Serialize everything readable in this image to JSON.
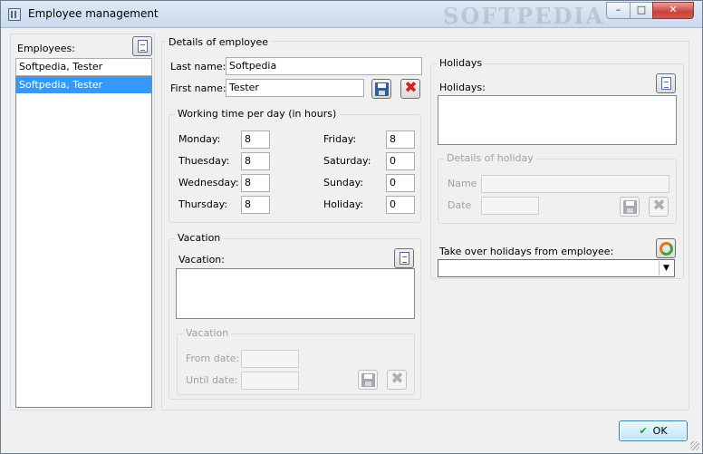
{
  "window": {
    "title": "Employee management",
    "watermark": "SOFTPEDIA",
    "min_glyph": "–",
    "max_glyph": "□",
    "close_glyph": "✕"
  },
  "employees": {
    "label": "Employees:",
    "search_value": "Softpedia, Tester",
    "items": [
      "Softpedia, Tester"
    ]
  },
  "details": {
    "group_title": "Details of employee",
    "last_name_label": "Last name:",
    "last_name_value": "Softpedia",
    "first_name_label": "First name:",
    "first_name_value": "Tester"
  },
  "working_time": {
    "title": "Working time per day (in hours)",
    "rows_left": [
      {
        "label": "Monday:",
        "value": "8"
      },
      {
        "label": "Thuesday:",
        "value": "8"
      },
      {
        "label": "Wednesday:",
        "value": "8"
      },
      {
        "label": "Thursday:",
        "value": "8"
      }
    ],
    "rows_right": [
      {
        "label": "Friday:",
        "value": "8"
      },
      {
        "label": "Saturday:",
        "value": "0"
      },
      {
        "label": "Sunday:",
        "value": "0"
      },
      {
        "label": "Holiday:",
        "value": "0"
      }
    ]
  },
  "vacation": {
    "title": "Vacation",
    "list_label": "Vacation:",
    "sub_title": "Vacation",
    "from_label": "From date:",
    "until_label": "Until date:"
  },
  "holidays": {
    "title": "Holidays",
    "list_label": "Holidays:",
    "details_title": "Details of holiday",
    "name_label": "Name",
    "date_label": "Date",
    "takeover_label": "Take over holidays from employee:"
  },
  "footer": {
    "ok_label": "OK",
    "ok_check": "✔"
  },
  "icons": {
    "delete_glyph": "✖",
    "combo_arrow": "▼"
  },
  "colors": {
    "selection": "#3399ff",
    "delete_red": "#d32020",
    "save_blue": "#2a5fa8"
  }
}
